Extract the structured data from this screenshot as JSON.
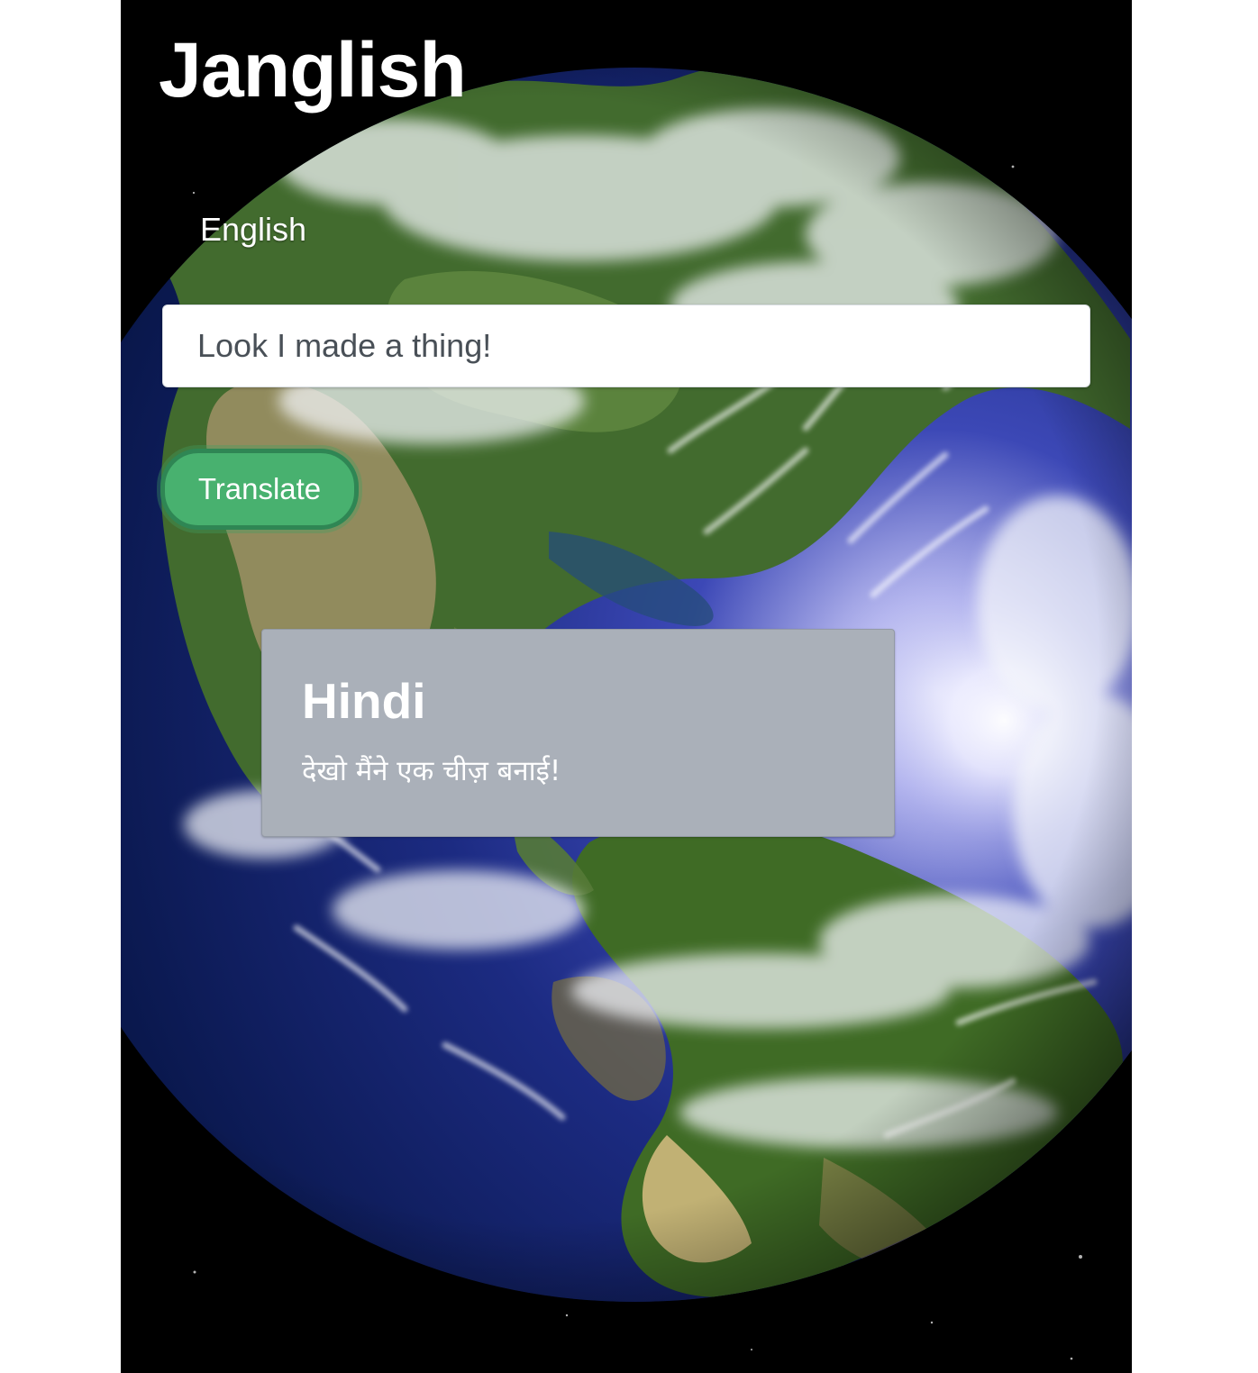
{
  "app": {
    "title": "Janglish"
  },
  "translator": {
    "source_language": "English",
    "input_value": "Look I made a thing!",
    "translate_button_label": "Translate"
  },
  "result": {
    "target_language": "Hindi",
    "translated_text": "देखो मैंने एक चीज़ बनाई!"
  },
  "colors": {
    "button_green": "#48b16f",
    "result_card": "#aab0b9",
    "space_background": "#000000"
  }
}
